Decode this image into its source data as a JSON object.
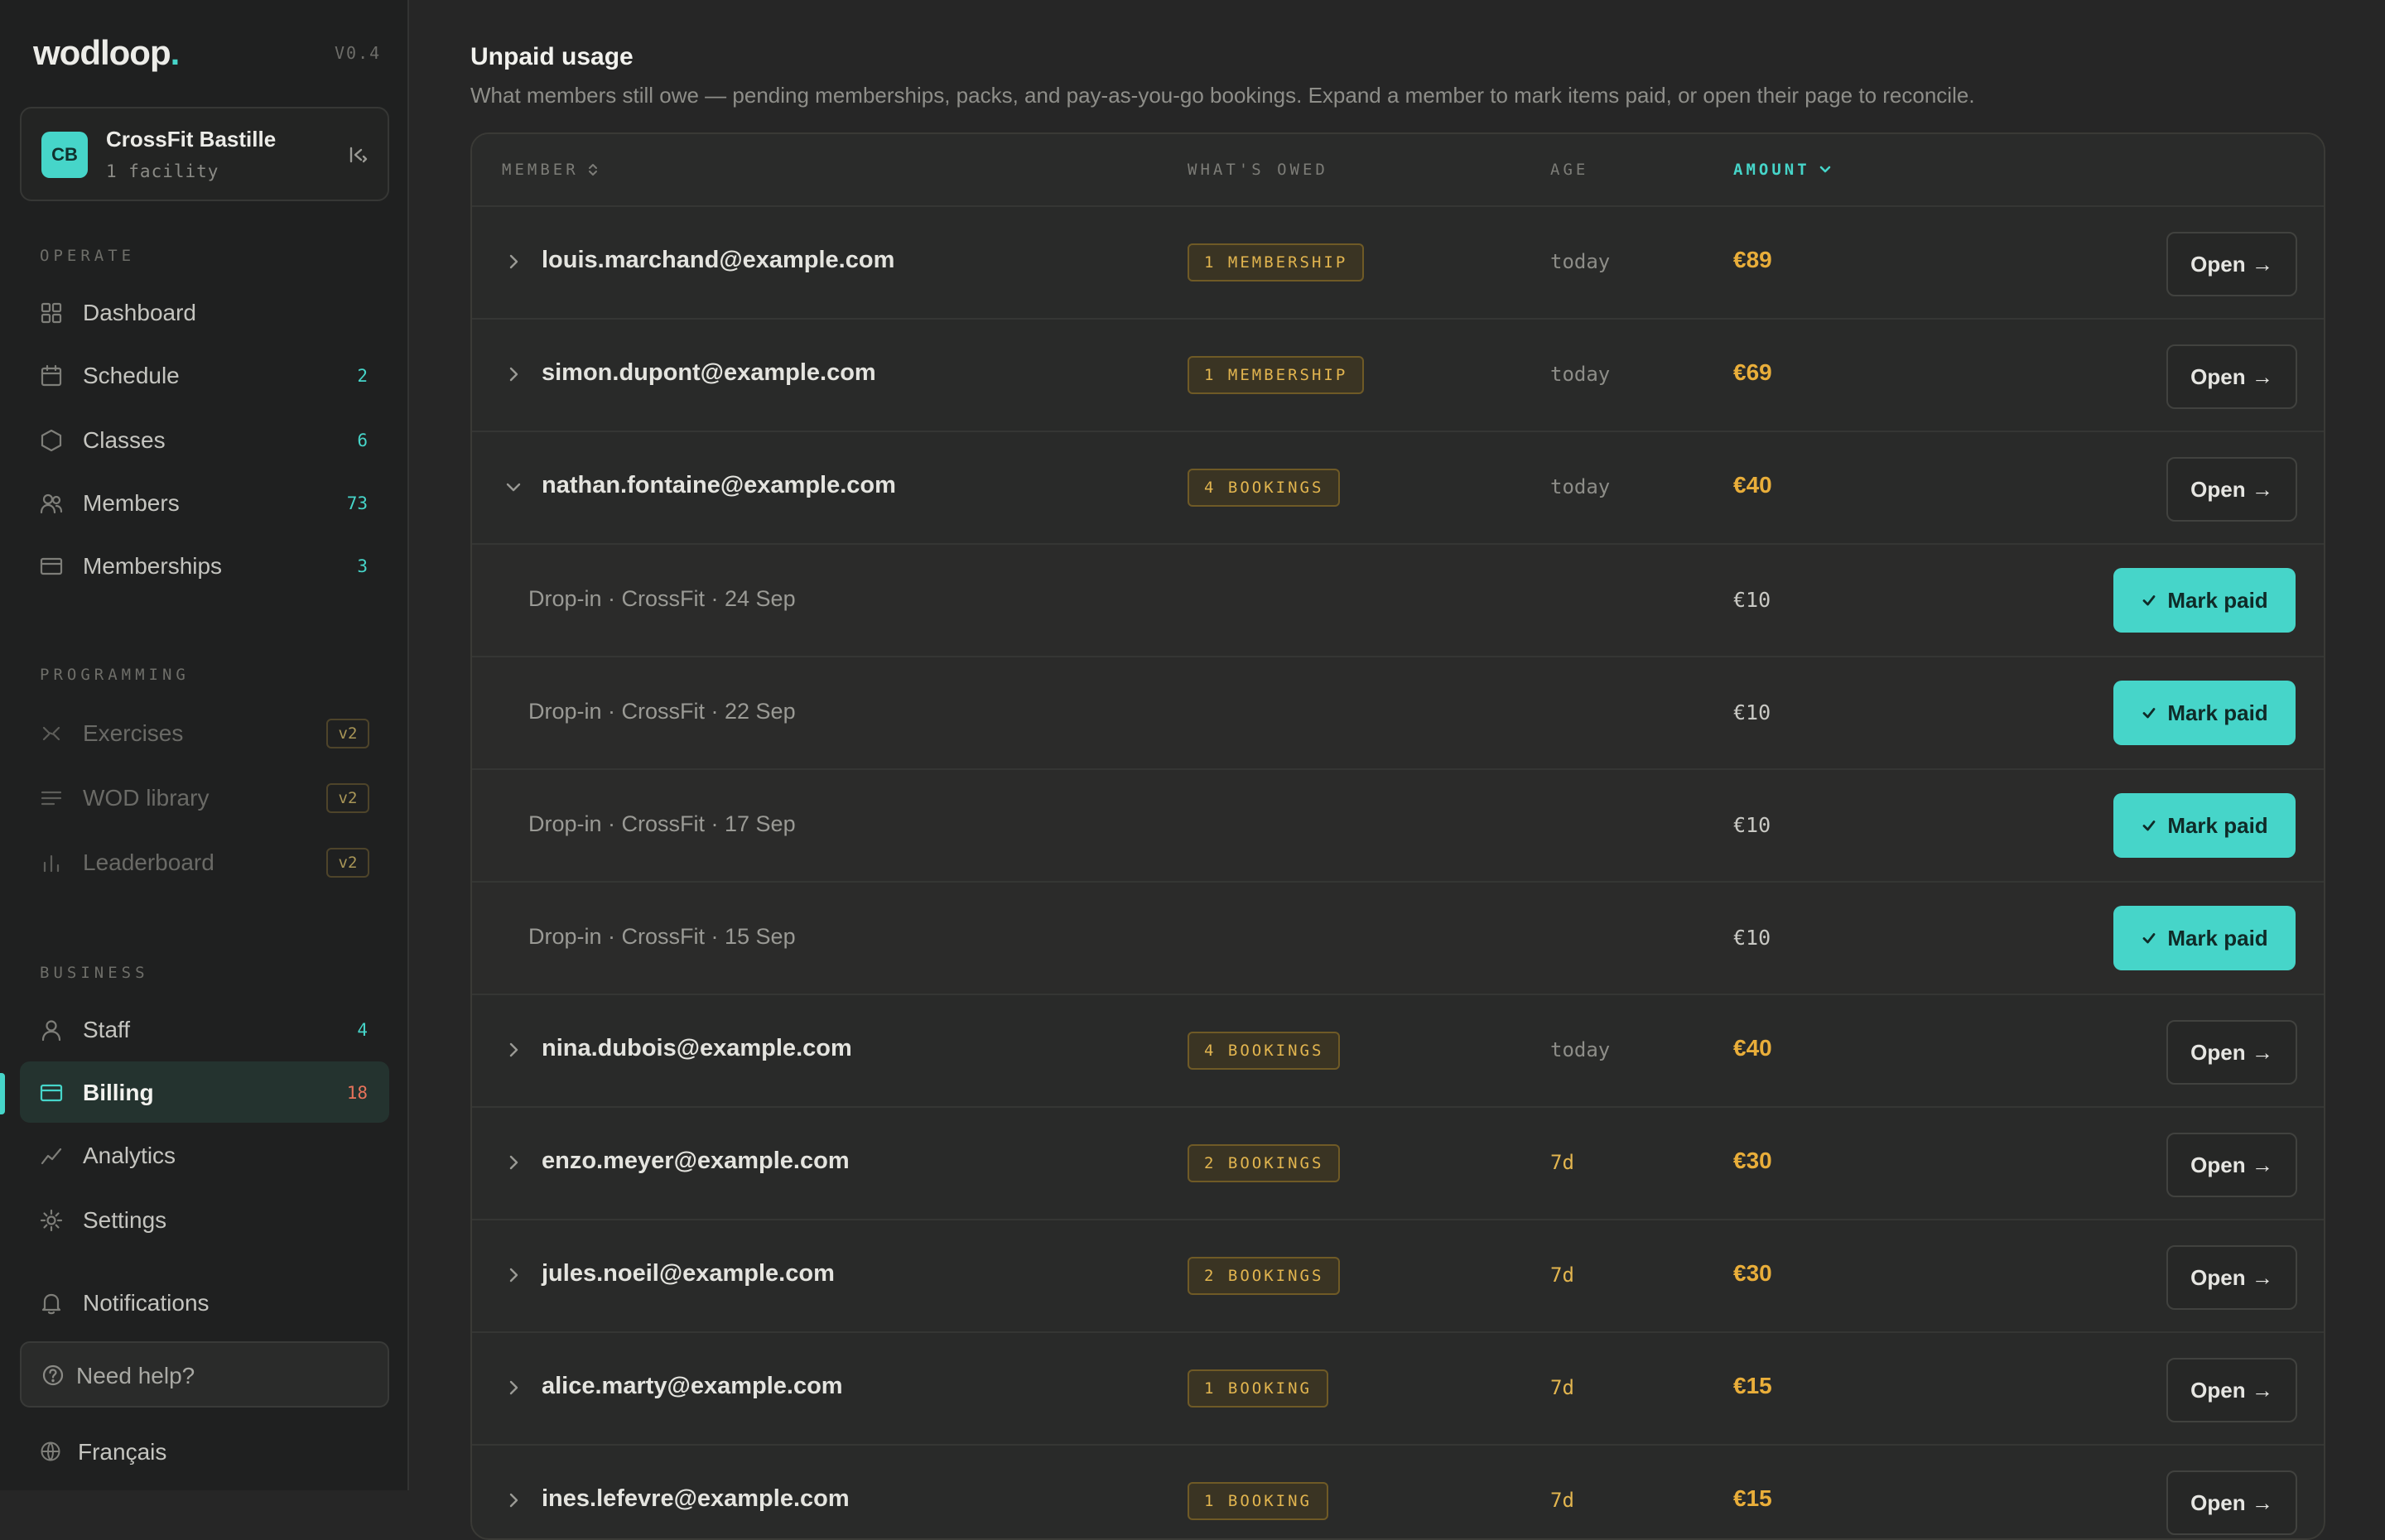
{
  "app": {
    "logo": "wodloop",
    "logo_dot": ".",
    "version": "V0.4"
  },
  "org": {
    "initials": "CB",
    "name": "CrossFit Bastille",
    "sub": "1 facility"
  },
  "sections": {
    "operate": "OPERATE",
    "programming": "PROGRAMMING",
    "business": "BUSINESS"
  },
  "nav": {
    "operate": [
      {
        "label": "Dashboard",
        "count": ""
      },
      {
        "label": "Schedule",
        "count": "2"
      },
      {
        "label": "Classes",
        "count": "6"
      },
      {
        "label": "Members",
        "count": "73"
      },
      {
        "label": "Memberships",
        "count": "3"
      }
    ],
    "programming": [
      {
        "label": "Exercises",
        "pill": "v2"
      },
      {
        "label": "WOD library",
        "pill": "v2"
      },
      {
        "label": "Leaderboard",
        "pill": "v2"
      }
    ],
    "business": [
      {
        "label": "Staff",
        "count": "4"
      },
      {
        "label": "Billing",
        "count": "18"
      },
      {
        "label": "Analytics",
        "count": ""
      },
      {
        "label": "Settings",
        "count": ""
      }
    ],
    "notifications": "Notifications",
    "help": "Need help?",
    "language": "Français"
  },
  "page": {
    "title": "Unpaid usage",
    "description": "What members still owe — pending memberships, packs, and pay-as-you-go bookings. Expand a member to mark items paid, or open their page to reconcile."
  },
  "table": {
    "headers": {
      "member": "MEMBER",
      "owed": "WHAT'S OWED",
      "age": "AGE",
      "amount": "AMOUNT"
    },
    "open_label": "Open →",
    "mark_paid_label": "Mark paid",
    "rows": [
      {
        "email": "louis.marchand@example.com",
        "owed": "1 MEMBERSHIP",
        "age": "today",
        "amount": "€89"
      },
      {
        "email": "simon.dupont@example.com",
        "owed": "1 MEMBERSHIP",
        "age": "today",
        "amount": "€69"
      },
      {
        "email": "nathan.fontaine@example.com",
        "owed": "4 BOOKINGS",
        "age": "today",
        "amount": "€40"
      },
      {
        "email": "nina.dubois@example.com",
        "owed": "4 BOOKINGS",
        "age": "today",
        "amount": "€40"
      },
      {
        "email": "enzo.meyer@example.com",
        "owed": "2 BOOKINGS",
        "age": "7d",
        "amount": "€30"
      },
      {
        "email": "jules.noeil@example.com",
        "owed": "2 BOOKINGS",
        "age": "7d",
        "amount": "€30"
      },
      {
        "email": "alice.marty@example.com",
        "owed": "1 BOOKING",
        "age": "7d",
        "amount": "€15"
      },
      {
        "email": "ines.lefevre@example.com",
        "owed": "1 BOOKING",
        "age": "7d",
        "amount": "€15"
      }
    ],
    "expanded_items": [
      {
        "label": "Drop-in · CrossFit · 24 Sep",
        "amount": "€10"
      },
      {
        "label": "Drop-in · CrossFit · 22 Sep",
        "amount": "€10"
      },
      {
        "label": "Drop-in · CrossFit · 17 Sep",
        "amount": "€10"
      },
      {
        "label": "Drop-in · CrossFit · 15 Sep",
        "amount": "€10"
      }
    ]
  },
  "colors": {
    "accent": "#46d5c9",
    "amount": "#e9ae3a",
    "alert": "#e8735b"
  }
}
